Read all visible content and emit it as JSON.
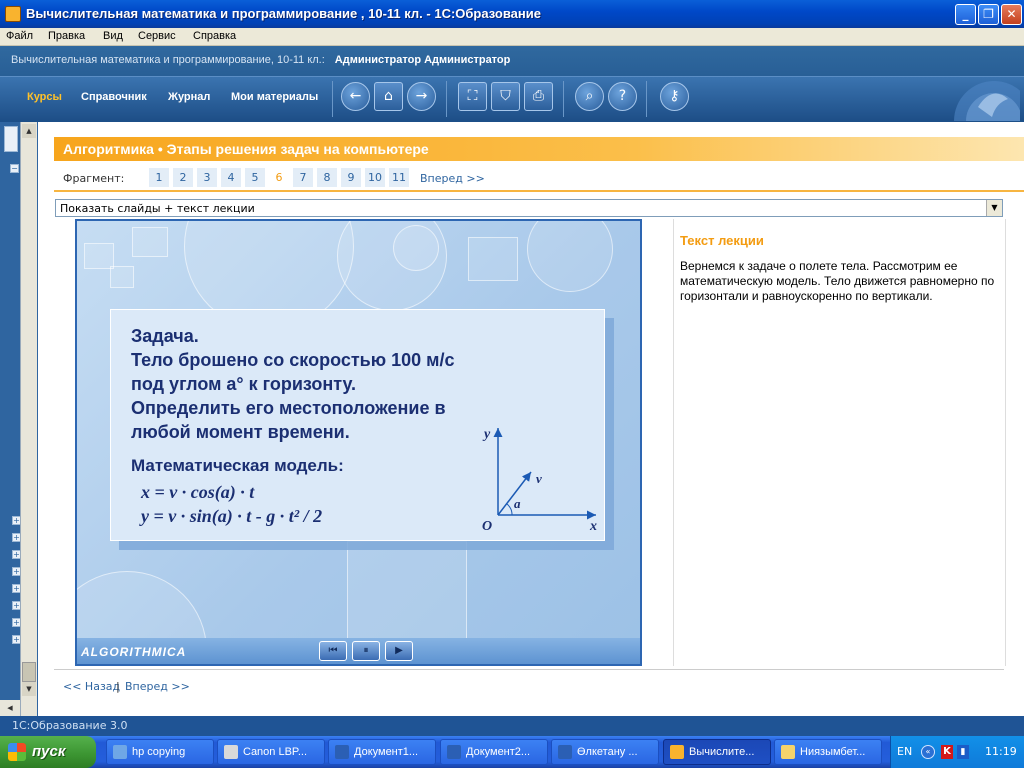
{
  "window": {
    "title": "Вычислительная математика и программирование , 10-11 кл. - 1С:Образование",
    "minimize": "_",
    "maximize": "❐",
    "close": "✕"
  },
  "menu": [
    "Файл",
    "Правка",
    "Вид",
    "Сервис",
    "Справка"
  ],
  "header": {
    "course": "Вычислительная математика и программирование, 10-11 кл.:",
    "user": "Администратор Администратор"
  },
  "nav": {
    "links": [
      "Курсы",
      "Справочник",
      "Журнал",
      "Мои материалы"
    ],
    "active": "Курсы",
    "icons": {
      "back": "←",
      "home": "⌂",
      "forward": "→",
      "fullscreen": "⛶",
      "present": "⛉",
      "print": "⎙",
      "search": "⌕",
      "help": "?",
      "key": "⚷"
    }
  },
  "section": {
    "title": "Алгоритмика • Этапы решения задач на компьютере"
  },
  "fragments": {
    "label": "Фрагмент:",
    "pages": [
      "1",
      "2",
      "3",
      "4",
      "5",
      "6",
      "7",
      "8",
      "9",
      "10",
      "11"
    ],
    "current": "6",
    "next": "Вперед >>"
  },
  "view_select": {
    "value": "Показать слайды + текст лекции"
  },
  "slide": {
    "lines": [
      "Задача.",
      "Тело брошено со скоростью 100 м/с",
      "под углом a° к горизонту.",
      "Определить его местоположение в",
      "любой момент времени."
    ],
    "model_title": "Математическая модель:",
    "formula_x": "x = v · cos(a) · t",
    "formula_y": "y = v · sin(a) · t - g · t² / 2",
    "axis_labels": {
      "y": "y",
      "x": "x",
      "origin": "O",
      "v": "v",
      "a": "a"
    },
    "brand": "ALGORITHMICA",
    "controls": {
      "first": "⏮",
      "pause": "⏸",
      "play": "▶"
    }
  },
  "lecture": {
    "heading": "Текст лекции",
    "text": "Вернемся к задаче о полете тела. Рассмотрим ее математическую модель. Тело движется равномерно по горизонтали и равноускоренно по вертикали."
  },
  "pager": {
    "back": "<< Назад",
    "separator": "|",
    "forward": "Вперед >>"
  },
  "status": {
    "text": "1С:Образование 3.0"
  },
  "taskbar": {
    "start": "пуск",
    "tasks": [
      {
        "label": "hp copying",
        "color": "#6fa7e6"
      },
      {
        "label": "Canon LBP...",
        "color": "#d9d9d9"
      },
      {
        "label": "Документ1...",
        "color": "#2b5fb4"
      },
      {
        "label": "Документ2...",
        "color": "#2b5fb4"
      },
      {
        "label": "Өлкетану ...",
        "color": "#2b5fb4"
      },
      {
        "label": "Вычислите...",
        "color": "#f9b32e"
      },
      {
        "label": "Ниязымбет...",
        "color": "#f5d36b"
      }
    ],
    "active_task": "Вычислите...",
    "lang": "EN",
    "tray_icons": [
      "«",
      "K",
      "▮"
    ],
    "time": "11:19"
  }
}
